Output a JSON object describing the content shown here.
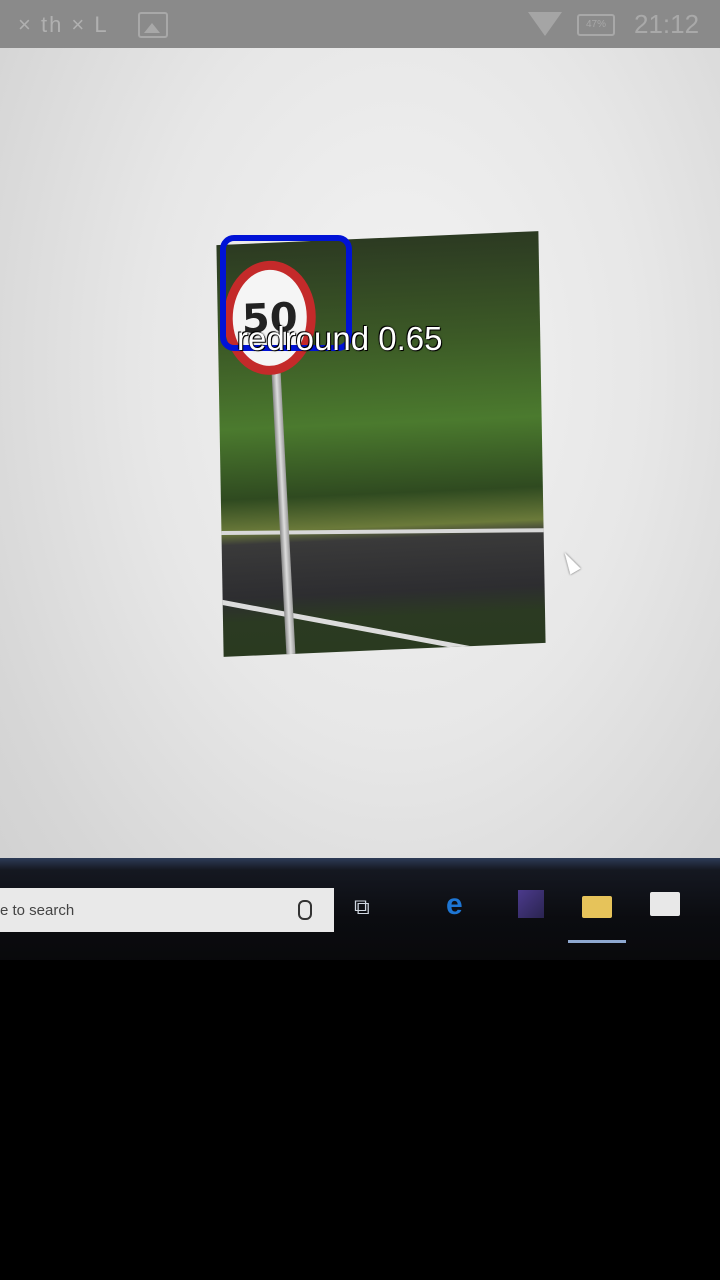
{
  "status_bar": {
    "left_text": "× th × L",
    "battery": "47%",
    "time": "21:12"
  },
  "detection": {
    "label": "redround 0.65",
    "box_color": "#0012d6"
  },
  "sign": {
    "speed": "50"
  },
  "taskbar": {
    "search_text": "e to search",
    "icons": [
      "task-view-icon",
      "edge-icon",
      "visual-studio-icon",
      "file-explorer-icon",
      "store-icon"
    ]
  }
}
